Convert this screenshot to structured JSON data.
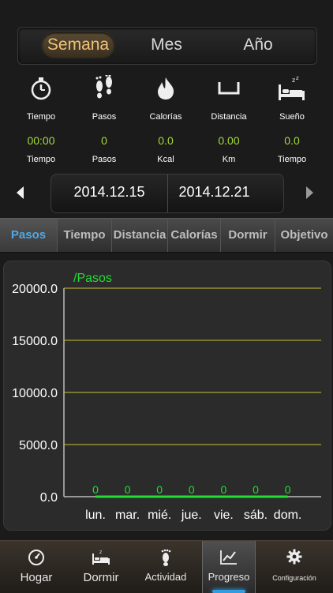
{
  "period_tabs": [
    {
      "label": "Semana",
      "active": true
    },
    {
      "label": "Mes",
      "active": false
    },
    {
      "label": "Año",
      "active": false
    }
  ],
  "stats": [
    {
      "icon": "stopwatch-icon",
      "name": "Tiempo",
      "value": "00:00",
      "unit": "Tiempo"
    },
    {
      "icon": "footprints-icon",
      "name": "Pasos",
      "value": "0",
      "unit": "Pasos"
    },
    {
      "icon": "flame-icon",
      "name": "Calorías",
      "value": "0.0",
      "unit": "Kcal"
    },
    {
      "icon": "distance-icon",
      "name": "Distancia",
      "value": "0.00",
      "unit": "Km"
    },
    {
      "icon": "sleep-bed-icon",
      "name": "Sueño",
      "value": "0.0",
      "unit": "Tiempo"
    }
  ],
  "date_range": {
    "start": "2014.12.15",
    "end": "2014.12.21"
  },
  "metric_tabs": [
    {
      "label": "Pasos",
      "active": true
    },
    {
      "label": "Tiempo",
      "active": false
    },
    {
      "label": "Distancia",
      "active": false
    },
    {
      "label": "Calorías",
      "active": false
    },
    {
      "label": "Dormir",
      "active": false
    },
    {
      "label": "Objetivo",
      "active": false
    }
  ],
  "colors": {
    "accent_green": "#a3d93b",
    "accent_blue": "#4ea8e6",
    "grid": "#c8c23a",
    "line": "#22dd33",
    "active_period": "#f0c277"
  },
  "chart_data": {
    "type": "line",
    "title": "/Pasos",
    "categories": [
      "lun.",
      "mar.",
      "mié.",
      "jue.",
      "vie.",
      "sáb.",
      "dom."
    ],
    "values": [
      0,
      0,
      0,
      0,
      0,
      0,
      0
    ],
    "yticks": [
      "20000.0",
      "15000.0",
      "10000.0",
      "5000.0",
      "0.0"
    ],
    "ylim": [
      0,
      20000
    ],
    "grid": true
  },
  "bottom_nav": [
    {
      "icon": "speedometer-icon",
      "label": "Hogar",
      "active": false
    },
    {
      "icon": "bed-icon",
      "label": "Dormir",
      "active": false
    },
    {
      "icon": "footprint-icon",
      "label": "Actividad",
      "active": false
    },
    {
      "icon": "progress-chart-icon",
      "label": "Progreso",
      "active": true
    },
    {
      "icon": "gear-icon",
      "label": "Configuración",
      "active": false
    }
  ]
}
